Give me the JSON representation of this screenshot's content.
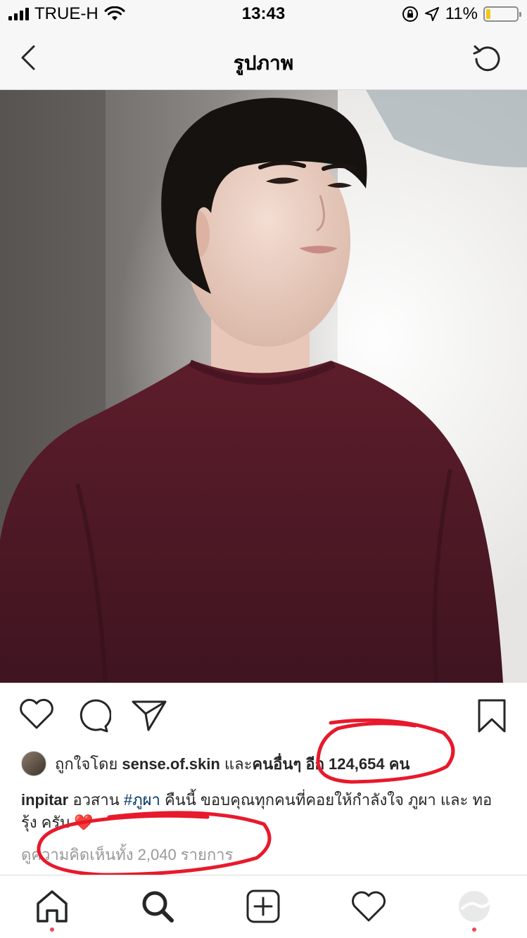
{
  "status_bar": {
    "carrier": "TRUE-H",
    "time": "13:43",
    "battery": "11%",
    "battery_level": 0.11,
    "icons": [
      "signal-icon",
      "wifi-icon",
      "orientation-lock-icon",
      "location-arrow-icon",
      "battery-icon"
    ]
  },
  "nav": {
    "title": "รูปภาพ",
    "back_icon": "chevron-left-icon",
    "refresh_icon": "refresh-icon"
  },
  "post": {
    "photo_icon": "post-photo",
    "actions": [
      "heart-icon",
      "comment-icon",
      "share-icon",
      "bookmark-icon"
    ],
    "likes": {
      "prefix": "ถูกใจโดย",
      "user": "sense.of.skin",
      "middle": "และ",
      "others": "คนอื่นๆ",
      "count_prefix": "อีก",
      "count": "124,654",
      "unit": "คน"
    },
    "caption": {
      "username": "inpitar",
      "text_before": "อวสาน",
      "hashtag": "#ภูผา",
      "text_after": "คืนนี้ ขอบคุณทุกคนที่คอยให้กำลังใจ ภูผา และ ทอรุ้ง ครับ",
      "emoji": "❤️"
    },
    "comments_link": "ดูความคิดเห็นทั้ง 2,040 รายการ"
  },
  "tab_bar": {
    "items": [
      "home-icon",
      "search-icon",
      "add-post-icon",
      "activity-icon",
      "profile-icon"
    ]
  },
  "colors": {
    "annotation": "#e8192c",
    "notification_dot": "#ed4956",
    "hashtag": "#003569",
    "muted": "#999999"
  }
}
